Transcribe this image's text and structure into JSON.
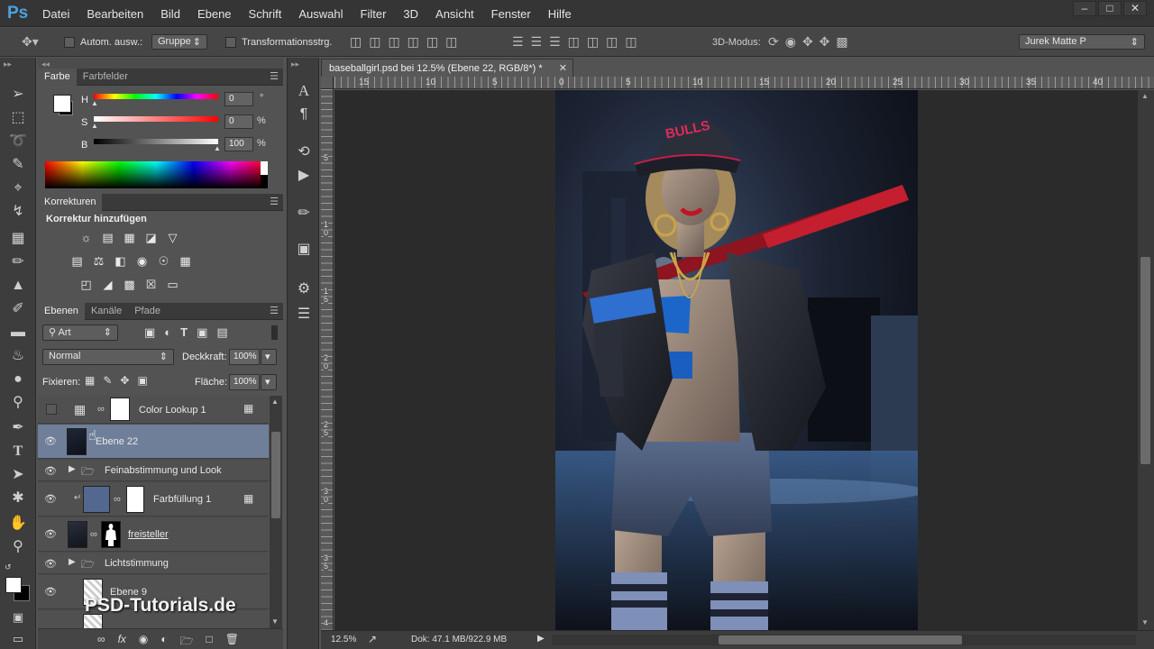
{
  "app": {
    "logo": "Ps"
  },
  "menubar": {
    "items": [
      "Datei",
      "Bearbeiten",
      "Bild",
      "Ebene",
      "Schrift",
      "Auswahl",
      "Filter",
      "3D",
      "Ansicht",
      "Fenster",
      "Hilfe"
    ]
  },
  "window_controls": [
    "minimize-icon",
    "restore-icon",
    "close-icon"
  ],
  "options_bar": {
    "auto_select_label": "Autom. ausw.:",
    "auto_select_value": "Gruppe",
    "transform_label": "Transformationsstrg.",
    "mode_3d_label": "3D-Modus:",
    "workspace_value": "Jurek Matte P"
  },
  "color_panel": {
    "tabs": [
      "Farbe",
      "Farbfelder"
    ],
    "h_label": "H",
    "h_value": "0",
    "h_unit": "°",
    "s_label": "S",
    "s_value": "0",
    "s_unit": "%",
    "b_label": "B",
    "b_value": "100",
    "b_unit": "%"
  },
  "adjustments_panel": {
    "tab": "Korrekturen",
    "heading": "Korrektur hinzufügen"
  },
  "layers_panel": {
    "tabs": [
      "Ebenen",
      "Kanäle",
      "Pfade"
    ],
    "filter_value": "Art",
    "blend_mode": "Normal",
    "opacity_label": "Deckkraft:",
    "opacity_value": "100%",
    "lock_label": "Fixieren:",
    "fill_label": "Fläche:",
    "fill_value": "100%",
    "layers": [
      {
        "name": "Color Lookup 1",
        "visible": false,
        "selected": false
      },
      {
        "name": "Ebene 22",
        "visible": true,
        "selected": true
      },
      {
        "name": "Feinabstimmung und Look",
        "visible": true,
        "selected": false
      },
      {
        "name": "Farbfüllung 1",
        "visible": true,
        "selected": false
      },
      {
        "name": "freisteller",
        "visible": true,
        "selected": false
      },
      {
        "name": "Lichtstimmung",
        "visible": true,
        "selected": false
      },
      {
        "name": "Ebene 9",
        "visible": true,
        "selected": false
      }
    ]
  },
  "document": {
    "tab_title": "baseballgirl.psd bei 12.5% (Ebene 22, RGB/8*) *",
    "ruler_top": [
      "15",
      "10",
      "5",
      "0",
      "5",
      "10",
      "15",
      "20",
      "25",
      "30",
      "35",
      "40"
    ],
    "ruler_left": [
      "5",
      "1\n0",
      "1\n5",
      "2\n0",
      "2\n5",
      "3\n0",
      "3\n5",
      "4"
    ],
    "cap_text": "BULLS"
  },
  "status": {
    "zoom": "12.5%",
    "doc_info": "Dok: 47.1 MB/922.9 MB"
  },
  "watermark": "PSD-Tutorials.de"
}
